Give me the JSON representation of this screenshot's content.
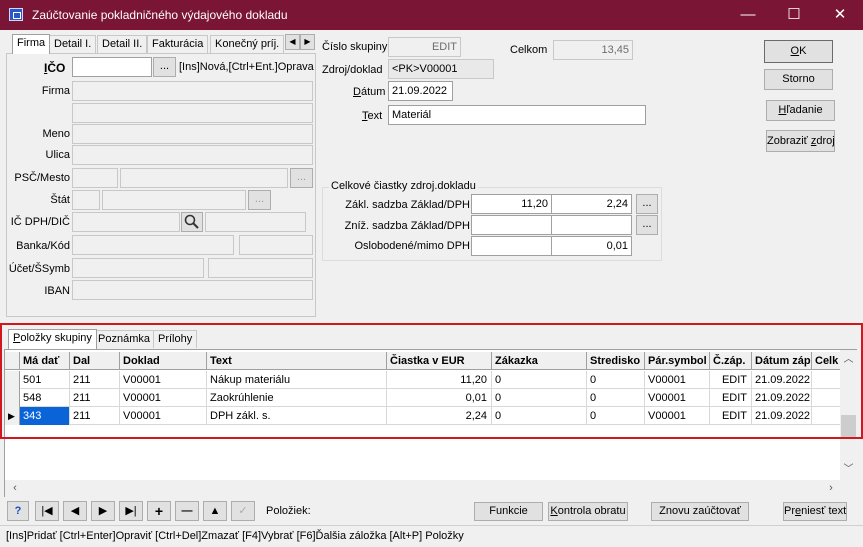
{
  "window": {
    "title": "Zaúčtovanie pokladničného výdajového dokladu",
    "min_label": "—",
    "max_label": "☐",
    "close_label": "✕"
  },
  "top_tabs": [
    "Firma",
    "Detail I.",
    "Detail II.",
    "Fakturácia",
    "Konečný príj."
  ],
  "firm": {
    "ico_label": "IČO",
    "ico_value": "",
    "ico_hint": "[Ins]Nová,[Ctrl+Ent.]Oprava",
    "firma_label": "Firma",
    "meno_label": "Meno",
    "ulica_label": "Ulica",
    "psc_label": "PSČ/Mesto",
    "stat_label": "Štát",
    "icdph_label": "IČ DPH/DIČ",
    "banka_label": "Banka/Kód",
    "ucet_label": "Účet/ŠSymb",
    "iban_label": "IBAN",
    "ellipsis": "..."
  },
  "group": {
    "cislo_label": "Číslo skupiny",
    "cislo_value": "EDIT",
    "celkom_label": "Celkom",
    "celkom_value": "13,45",
    "zdroj_label": "Zdroj/doklad",
    "zdroj_value": "<PK>V00001",
    "datum_label": "Dátum",
    "datum_value": "21.09.2022",
    "text_label": "Text",
    "text_value": "Materiál"
  },
  "totals": {
    "title": "Celkové čiastky zdroj.dokladu",
    "zakl_label": "Zákl. sadzba  Základ/DPH",
    "zakl_zaklad": "11,20",
    "zakl_dph": "2,24",
    "zniz_label": "Zníž. sadzba Základ/DPH",
    "zniz_zaklad": "",
    "zniz_dph": "",
    "oslob_label": "Oslobodené/mimo DPH",
    "oslob_zaklad": "",
    "oslob_dph": "0,01"
  },
  "actions": {
    "ok": "OK",
    "storno": "Storno",
    "hladanie": "Hľadanie",
    "zobrazit": "Zobraziť zdroj"
  },
  "bottom_tabs": [
    "Položky skupiny",
    "Poznámka",
    "Prílohy"
  ],
  "grid": {
    "headers": [
      "Má dať",
      "Dal",
      "Doklad",
      "Text",
      "Čiastka v EUR",
      "Zákazka",
      "Stredisko",
      "Pár.symbol",
      "Č.záp.",
      "Dátum záp",
      "Celk"
    ],
    "rows": [
      [
        "501",
        "211",
        "V00001",
        "Nákup materiálu",
        "11,20",
        "0",
        "0",
        "V00001",
        "EDIT",
        "21.09.2022"
      ],
      [
        "548",
        "211",
        "V00001",
        "Zaokrúhlenie",
        "0,01",
        "0",
        "0",
        "V00001",
        "EDIT",
        "21.09.2022"
      ],
      [
        "343",
        "211",
        "V00001",
        "DPH zákl. s.",
        "2,24",
        "0",
        "0",
        "V00001",
        "EDIT",
        "21.09.2022"
      ]
    ]
  },
  "toolbar": {
    "help": "?",
    "first": "|◀",
    "prev": "◀",
    "next": "▶",
    "last": "▶|",
    "add": "+",
    "remove": "—",
    "up": "▲",
    "check": "✓",
    "polozky_label": "Položiek:",
    "funkcie": "Funkcie",
    "kontrola": "Kontrola obratu",
    "znovu": "Znovu zaúčtovať",
    "preniest": "Preniesť text"
  },
  "status_text": "[Ins]Pridať [Ctrl+Enter]Opraviť [Ctrl+Del]Zmazať [F4]Vybrať [F6]Ďalšia záložka [Alt+P] Položky",
  "highlight_color": "#d0181e",
  "selection_color": "#0a64d8"
}
